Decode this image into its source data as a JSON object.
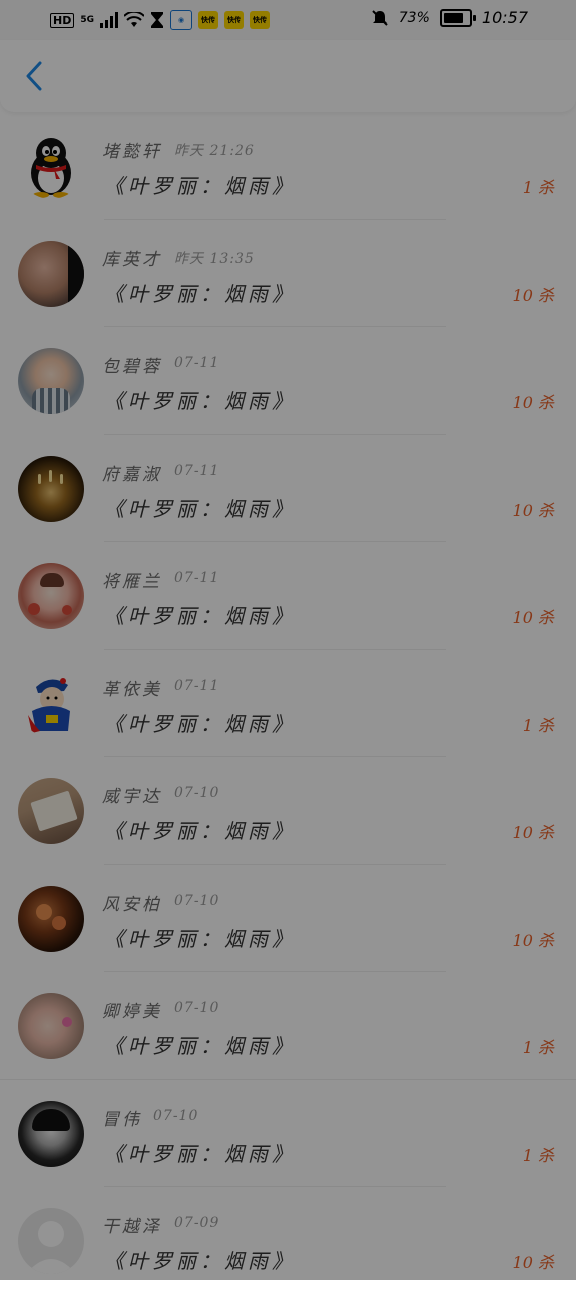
{
  "status_bar": {
    "hd_label": "HD",
    "network_label": "5G",
    "app_icon_1": "快传",
    "app_icon_2": "快传",
    "app_icon_3": "快传",
    "battery_percent": "73%",
    "battery_level": 0.73,
    "time": "10:57"
  },
  "header": {
    "back_icon": "chevron-left-icon",
    "accent_color": "#1e88e5"
  },
  "list": {
    "count_color": "#e8612a",
    "items": [
      {
        "name": "堵懿轩",
        "time": "昨天 21:26",
        "song": "《叶罗丽：烟雨》",
        "count": "1 杀",
        "avatar": "qq-penguin"
      },
      {
        "name": "库英才",
        "time": "昨天 13:35",
        "song": "《叶罗丽：烟雨》",
        "count": "10 杀",
        "avatar": "girl-photo"
      },
      {
        "name": "包碧蓉",
        "time": "07-11",
        "song": "《叶罗丽：烟雨》",
        "count": "10 杀",
        "avatar": "baby-photo"
      },
      {
        "name": "府嘉淑",
        "time": "07-11",
        "song": "《叶罗丽：烟雨》",
        "count": "10 杀",
        "avatar": "candles-photo"
      },
      {
        "name": "将雁兰",
        "time": "07-11",
        "song": "《叶罗丽：烟雨》",
        "count": "10 杀",
        "avatar": "illustration"
      },
      {
        "name": "革依美",
        "time": "07-11",
        "song": "《叶罗丽：烟雨》",
        "count": "1 杀",
        "avatar": "cartoon"
      },
      {
        "name": "威宇达",
        "time": "07-10",
        "song": "《叶罗丽：烟雨》",
        "count": "10 杀",
        "avatar": "book-photo"
      },
      {
        "name": "风安柏",
        "time": "07-10",
        "song": "《叶罗丽：烟雨》",
        "count": "10 杀",
        "avatar": "flowers-photo"
      },
      {
        "name": "卿婷美",
        "time": "07-10",
        "song": "《叶罗丽：烟雨》",
        "count": "1 杀",
        "avatar": "kids-photo"
      },
      {
        "name": "冒伟",
        "time": "07-10",
        "song": "《叶罗丽：烟雨》",
        "count": "1 杀",
        "avatar": "bw-portrait"
      },
      {
        "name": "干越泽",
        "time": "07-09",
        "song": "《叶罗丽：烟雨》",
        "count": "10 杀",
        "avatar": "default-avatar"
      }
    ]
  }
}
